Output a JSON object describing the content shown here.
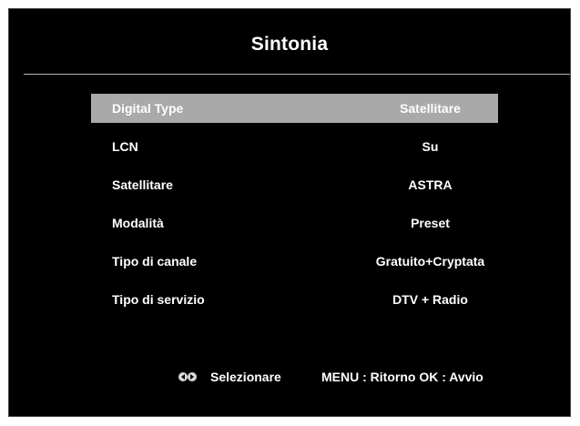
{
  "header": {
    "title": "Sintonia"
  },
  "menu": {
    "items": [
      {
        "label": "Digital Type",
        "value": "Satellitare",
        "selected": true
      },
      {
        "label": "LCN",
        "value": "Su",
        "selected": false
      },
      {
        "label": "Satellitare",
        "value": "ASTRA",
        "selected": false
      },
      {
        "label": "Modalità",
        "value": "Preset",
        "selected": false
      },
      {
        "label": "Tipo di canale",
        "value": "Gratuito+Cryptata",
        "selected": false
      },
      {
        "label": "Tipo di servizio",
        "value": "DTV + Radio",
        "selected": false
      }
    ]
  },
  "footer": {
    "icon": "navigation-arrows-icon",
    "select_label": "Selezionare",
    "help_text": "MENU : Ritorno OK : Avvio"
  },
  "colors": {
    "background": "#000000",
    "text": "#ffffff",
    "highlight": "#a9a9a9",
    "divider": "#b5b5b5"
  }
}
